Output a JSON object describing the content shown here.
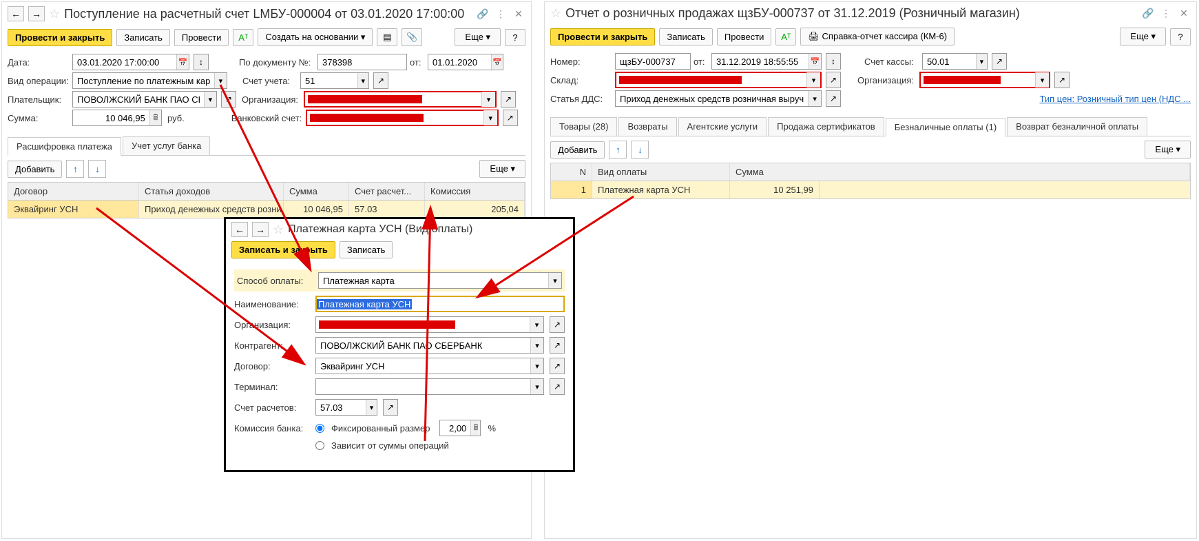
{
  "left": {
    "title": "Поступление на расчетный счет LМБУ-000004 от 03.01.2020 17:00:00",
    "btn_post_close": "Провести и закрыть",
    "btn_save": "Записать",
    "btn_post": "Провести",
    "btn_create_based": "Создать на основании",
    "btn_more": "Еще",
    "lbl_date": "Дата:",
    "val_date": "03.01.2020 17:00:00",
    "lbl_docno": "По документу №:",
    "val_docno": "378398",
    "lbl_from": "от:",
    "val_from": "01.01.2020",
    "lbl_op": "Вид операции:",
    "val_op": "Поступление по платежным картам",
    "lbl_account": "Счет учета:",
    "val_account": "51",
    "lbl_payer": "Плательщик:",
    "val_payer": "ПОВОЛЖСКИЙ БАНК ПАО СБЕРБА...",
    "lbl_org": "Организация:",
    "lbl_sum": "Сумма:",
    "val_sum": "10 046,95",
    "unit_sum": "руб.",
    "lbl_bankacc": "Банковский счет:",
    "tab_decode": "Расшифровка платежа",
    "tab_services": "Учет услуг банка",
    "btn_add": "Добавить",
    "col_contract": "Договор",
    "col_income": "Статья доходов",
    "col_amount": "Сумма",
    "col_settle": "Счет расчет...",
    "col_commission": "Комиссия",
    "row1_contract": "Эквайринг УСН",
    "row1_income": "Приход денежных средств розни...",
    "row1_amount": "10 046,95",
    "row1_settle": "57.03",
    "row1_commission": "205,04"
  },
  "right": {
    "title": "Отчет о розничных продажах щзБУ-000737 от 31.12.2019 (Розничный магазин)",
    "btn_post_close": "Провести и закрыть",
    "btn_save": "Записать",
    "btn_post": "Провести",
    "btn_report": "Справка-отчет кассира (КМ-6)",
    "btn_more": "Еще",
    "lbl_number": "Номер:",
    "val_number": "щзБУ-000737",
    "lbl_from": "от:",
    "val_from": "31.12.2019 18:55:55",
    "lbl_cashacc": "Счет кассы:",
    "val_cashacc": "50.01",
    "lbl_warehouse": "Склад:",
    "lbl_org": "Организация:",
    "lbl_dds": "Статья ДДС:",
    "val_dds": "Приход денежных средств розничная выручка+",
    "link_pricetype": "Тип цен: Розничный тип цен (НДС ...",
    "tab_goods": "Товары (28)",
    "tab_returns": "Возвраты",
    "tab_agent": "Агентские услуги",
    "tab_certs": "Продажа сертификатов",
    "tab_cashless": "Безналичные оплаты (1)",
    "tab_retcashless": "Возврат безналичной оплаты",
    "btn_add": "Добавить",
    "col_n": "N",
    "col_paytype": "Вид оплаты",
    "col_sum": "Сумма",
    "row1_n": "1",
    "row1_paytype": "Платежная карта УСН",
    "row1_sum": "10 251,99"
  },
  "dialog": {
    "title": "Платежная карта УСН (Вид оплаты)",
    "btn_save_close": "Записать и закрыть",
    "btn_save": "Записать",
    "lbl_method": "Способ оплаты:",
    "val_method": "Платежная карта",
    "lbl_name": "Наименование:",
    "val_name": "Платежная карта УСН",
    "lbl_org": "Организация:",
    "lbl_contragent": "Контрагент:",
    "val_contragent": "ПОВОЛЖСКИЙ БАНК ПАО СБЕРБАНК",
    "lbl_contract": "Договор:",
    "val_contract": "Эквайринг УСН",
    "lbl_terminal": "Терминал:",
    "lbl_settleacc": "Счет расчетов:",
    "val_settleacc": "57.03",
    "lbl_commission": "Комиссия банка:",
    "radio_fixed": "Фиксированный размер",
    "val_commission": "2,00",
    "unit_commission": "%",
    "radio_depends": "Зависит от суммы операций"
  }
}
